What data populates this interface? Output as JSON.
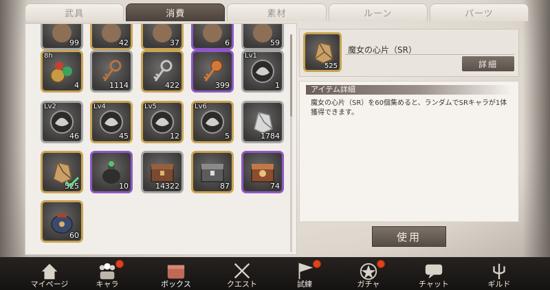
{
  "tabs": [
    {
      "label": "武具",
      "active": false
    },
    {
      "label": "消費",
      "active": true
    },
    {
      "label": "素材",
      "active": false
    },
    {
      "label": "ルーン",
      "active": false
    },
    {
      "label": "パーツ",
      "active": false
    }
  ],
  "inventory": {
    "items": [
      {
        "icon": "partial-item-icon",
        "qty": "99",
        "border": "silver",
        "level": ""
      },
      {
        "icon": "partial-item-icon",
        "qty": "42",
        "border": "gold",
        "level": ""
      },
      {
        "icon": "partial-item-icon",
        "qty": "37",
        "border": "gold",
        "level": ""
      },
      {
        "icon": "partial-item-icon",
        "qty": "6",
        "border": "purple",
        "level": ""
      },
      {
        "icon": "partial-item-icon",
        "qty": "59",
        "border": "silver",
        "level": ""
      },
      {
        "icon": "coins-orbs-icon",
        "qty": "4",
        "border": "gold",
        "level": "8h"
      },
      {
        "icon": "bronze-key-icon",
        "qty": "1114",
        "border": "silver",
        "level": ""
      },
      {
        "icon": "silver-key-icon",
        "qty": "422",
        "border": "gold",
        "level": ""
      },
      {
        "icon": "ornate-key-icon",
        "qty": "399",
        "border": "purple",
        "level": ""
      },
      {
        "icon": "crest-medallion-icon",
        "qty": "1",
        "border": "silver",
        "level": "Lv1"
      },
      {
        "icon": "crest-medallion-icon",
        "qty": "46",
        "border": "silver",
        "level": "Lv2"
      },
      {
        "icon": "crest-medallion-icon",
        "qty": "45",
        "border": "gold",
        "level": "Lv4"
      },
      {
        "icon": "crest-medallion-icon",
        "qty": "12",
        "border": "gold",
        "level": "Lv5"
      },
      {
        "icon": "crest-medallion-icon",
        "qty": "5",
        "border": "gold",
        "level": "Lv6"
      },
      {
        "icon": "silver-shard-icon",
        "qty": "1784",
        "border": "silver",
        "level": ""
      },
      {
        "icon": "gold-shard-icon",
        "qty": "525",
        "border": "gold",
        "level": "",
        "selected": true
      },
      {
        "icon": "potion-pot-icon",
        "qty": "10",
        "border": "purple",
        "level": ""
      },
      {
        "icon": "bronze-chest-icon",
        "qty": "14322",
        "border": "silver",
        "level": ""
      },
      {
        "icon": "silver-chest-icon",
        "qty": "87",
        "border": "gold",
        "level": ""
      },
      {
        "icon": "ornate-chest-icon",
        "qty": "74",
        "border": "purple",
        "level": ""
      },
      {
        "icon": "treasure-bag-icon",
        "qty": "60",
        "border": "gold",
        "level": ""
      }
    ]
  },
  "detail": {
    "name": "魔女の心片（SR）",
    "qty": "525",
    "detail_button": "詳細",
    "section_title": "アイテム詳細",
    "description": "魔女の心片（SR）を60個集めると、ランダムでSRキャラが1体獲得できます。",
    "use_button": "使用"
  },
  "nav": [
    {
      "label": "マイページ",
      "icon": "home-icon",
      "badge": false,
      "active": false
    },
    {
      "label": "キャラ",
      "icon": "characters-icon",
      "badge": true,
      "active": false
    },
    {
      "label": "ボックス",
      "icon": "box-icon",
      "badge": false,
      "active": true
    },
    {
      "label": "クエスト",
      "icon": "crossed-swords-icon",
      "badge": false,
      "active": false
    },
    {
      "label": "試練",
      "icon": "flag-icon",
      "badge": true,
      "active": false
    },
    {
      "label": "ガチャ",
      "icon": "gacha-star-icon",
      "badge": true,
      "active": false
    },
    {
      "label": "チャット",
      "icon": "chat-icon",
      "badge": false,
      "active": false
    },
    {
      "label": "ギルド",
      "icon": "guild-trident-icon",
      "badge": false,
      "active": false
    }
  ],
  "colors": {
    "gold_border": "#c9a453",
    "purple_border": "#8f58c6",
    "silver_border": "#a6a6a6",
    "badge": "#e0421f"
  }
}
